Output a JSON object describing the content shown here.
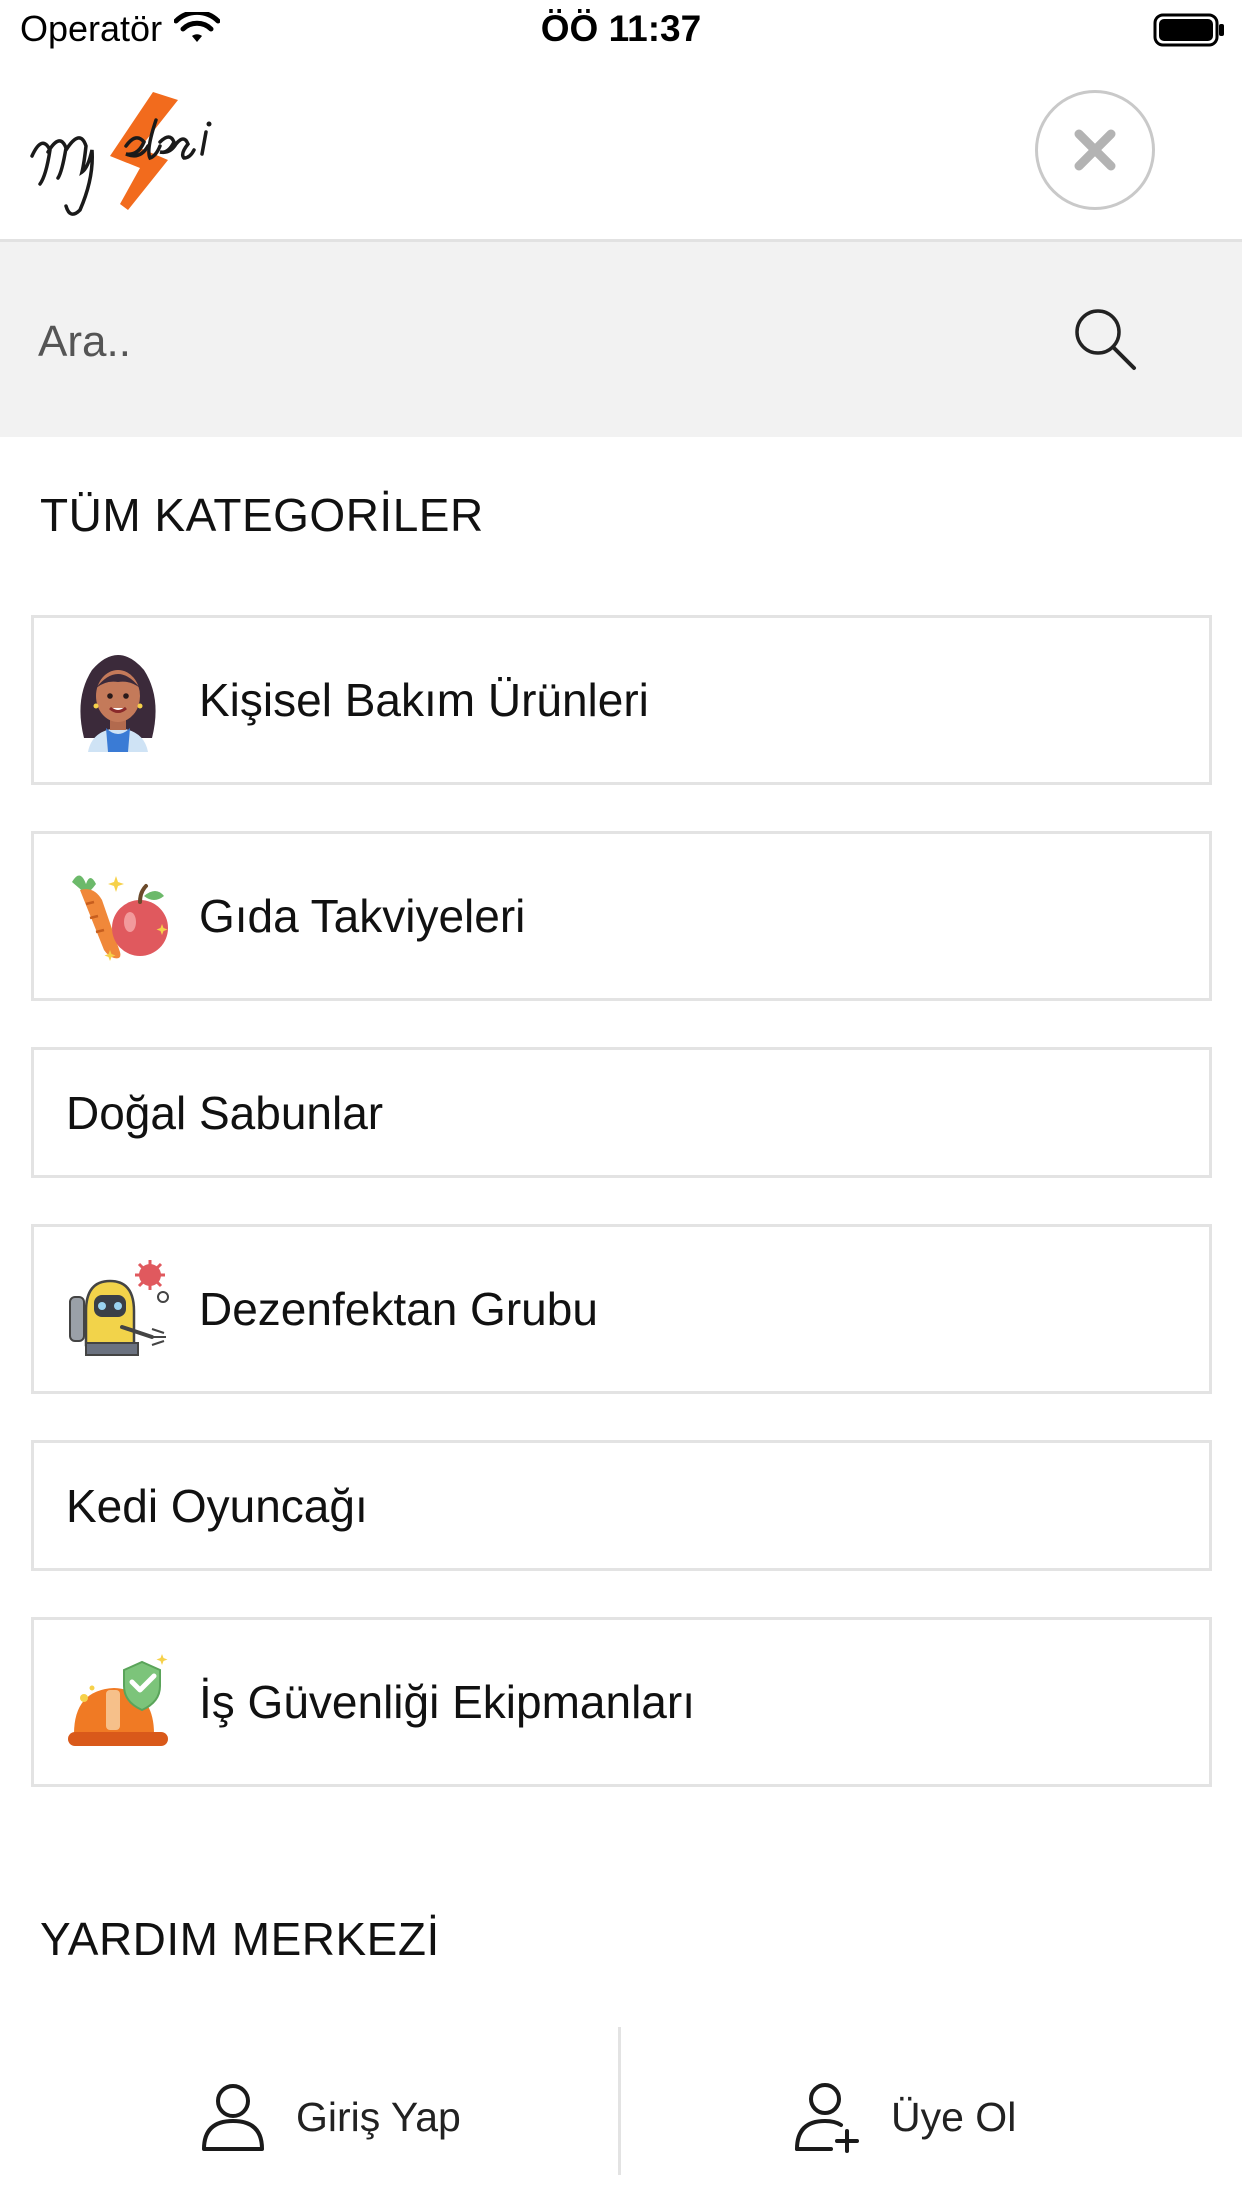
{
  "status_bar": {
    "carrier": "Operatör",
    "time": "ÖÖ 11:37"
  },
  "header": {
    "logo_text": "myelcsi",
    "close_icon": "close-icon"
  },
  "search": {
    "placeholder": "Ara..",
    "icon": "search-icon"
  },
  "categories_section": {
    "title": "TÜM KATEGORİLER",
    "items": [
      {
        "label": "Kişisel Bakım Ürünleri",
        "icon": "woman-avatar-icon"
      },
      {
        "label": "Gıda Takviyeleri",
        "icon": "fruit-vegetable-icon"
      },
      {
        "label": "Doğal Sabunlar"
      },
      {
        "label": "Dezenfektan Grubu",
        "icon": "disinfection-worker-icon"
      },
      {
        "label": "Kedi Oyuncağı"
      },
      {
        "label": "İş Güvenliği Ekipmanları",
        "icon": "safety-helmet-icon"
      }
    ]
  },
  "help_section": {
    "title": "YARDIM MERKEZİ"
  },
  "bottom_bar": {
    "login_label": "Giriş Yap",
    "register_label": "Üye Ol"
  },
  "colors": {
    "accent_orange": "#f26b1d",
    "border": "#e3e3e3",
    "search_bg": "#f2f2f2"
  }
}
